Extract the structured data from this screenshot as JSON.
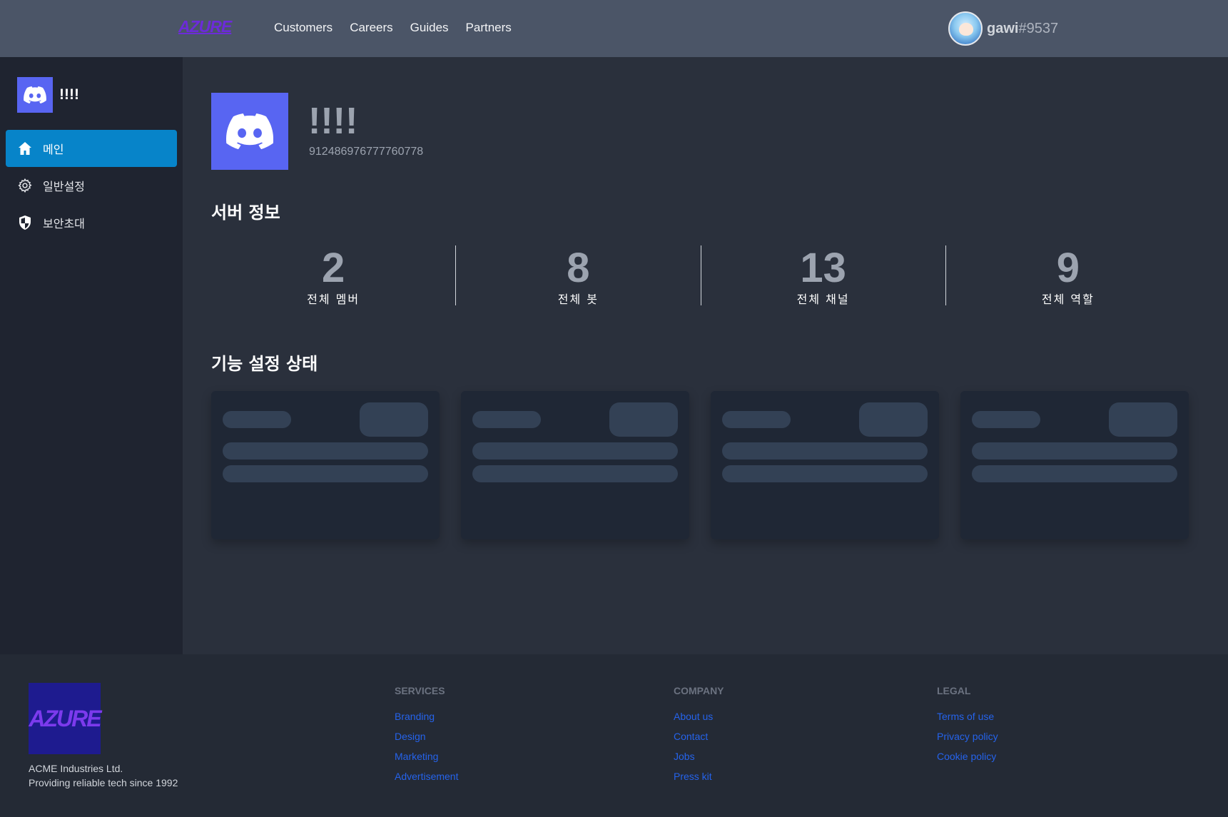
{
  "navbar": {
    "logo_text": "AZURE",
    "links": [
      "Customers",
      "Careers",
      "Guides",
      "Partners"
    ],
    "user": {
      "name": "gawi",
      "tag": "#9537"
    }
  },
  "sidebar": {
    "server_name": "!!!!",
    "items": [
      {
        "label": "메인",
        "icon": "home-icon",
        "active": true
      },
      {
        "label": "일반설정",
        "icon": "gear-icon",
        "active": false
      },
      {
        "label": "보안초대",
        "icon": "shield-icon",
        "active": false
      }
    ]
  },
  "main": {
    "server_name": "!!!!",
    "server_id": "912486976777760778",
    "server_info_title": "서버 정보",
    "stats": [
      {
        "value": "2",
        "label": "전체 멤버"
      },
      {
        "value": "8",
        "label": "전체 봇"
      },
      {
        "value": "13",
        "label": "전체 채널"
      },
      {
        "value": "9",
        "label": "전체 역할"
      }
    ],
    "feature_title": "기능 설정 상태"
  },
  "footer": {
    "logo_text": "AZURE",
    "company_name": "ACME Industries Ltd.",
    "company_tagline": "Providing reliable tech since 1992",
    "columns": [
      {
        "title": "Services",
        "links": [
          "Branding",
          "Design",
          "Marketing",
          "Advertisement"
        ]
      },
      {
        "title": "Company",
        "links": [
          "About us",
          "Contact",
          "Jobs",
          "Press kit"
        ]
      },
      {
        "title": "Legal",
        "links": [
          "Terms of use",
          "Privacy policy",
          "Cookie policy"
        ]
      }
    ]
  },
  "colors": {
    "navbar": "#4b5567",
    "sidebar": "#1f2430",
    "main": "#2a303c",
    "accent": "#0784c9",
    "discord": "#5865f2",
    "link": "#2563eb"
  }
}
